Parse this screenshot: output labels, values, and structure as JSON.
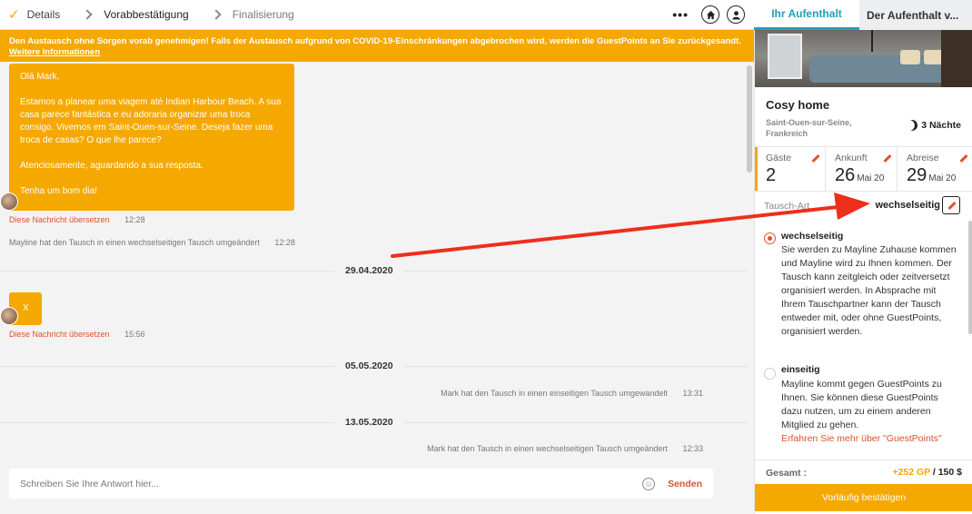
{
  "steps": [
    {
      "label": "Details",
      "state": "done"
    },
    {
      "label": "Vorabbestätigung",
      "state": "active"
    },
    {
      "label": "Finalisierung",
      "state": "pending"
    }
  ],
  "top_actions": {
    "more": "•••",
    "home_icon": "home-icon",
    "user_icon": "user-icon"
  },
  "tabs": {
    "active": "Ihr Aufenthalt",
    "inactive": "Der Aufenthalt v..."
  },
  "banner": {
    "text": "Den Austausch ohne Sorgen vorab genehmigen! Falls der Austausch aufgrund von COVID-19-Einschränkungen abgebrochen wird, werden die GuestPoints an Sie zurückgesandt.",
    "link": "Weitere Informationen"
  },
  "messages": {
    "first": {
      "greeting": "Olá Mark,",
      "body": "Estamos a planear uma viagem até Indian Harbour Beach. A sua casa parece fantástica e eu adoraria organizar uma troca consigo. Vivemos em Saint-Ouen-sur-Seine. Deseja fazer uma troca de casas? O que lhe parece?",
      "closing": "Atenciosamente, aguardando a sua resposta.",
      "sign": "Tenha um bom dia!",
      "translate": "Diese Nachricht übersetzen",
      "time": "12:28"
    },
    "system1": {
      "text": "Mayline hat den Tausch in einen wechselseitigen Tausch umgeändert",
      "time": "12:28"
    },
    "date1": "29.04.2020",
    "second": {
      "body": "X",
      "translate": "Diese Nachricht übersetzen",
      "time": "15:56"
    },
    "date2": "05.05.2020",
    "system2": {
      "text": "Mark hat den Tausch in einen einseitigen Tausch umgewandelt",
      "time": "13:31"
    },
    "date3": "13.05.2020",
    "system3": {
      "text": "Mark hat den Tausch in einen wechselseitigen Tausch umgeändert",
      "time": "12:33"
    }
  },
  "reply": {
    "placeholder": "Schreiben Sie Ihre Antwort hier...",
    "send": "Senden"
  },
  "home": {
    "title": "Cosy home",
    "location": "Saint-Ouen-sur-Seine, Frankreich",
    "nights": "3 Nächte"
  },
  "stay": {
    "guests": {
      "label": "Gäste",
      "value": "2"
    },
    "arrival": {
      "label": "Ankunft",
      "day": "26",
      "month": "Mai 20"
    },
    "departure": {
      "label": "Abreise",
      "day": "29",
      "month": "Mai 20"
    }
  },
  "exchange_type": {
    "label": "Tausch-Art",
    "value": "wechselseitig"
  },
  "options": [
    {
      "title": "wechselseitig",
      "selected": true,
      "desc": "Sie werden zu Mayline Zuhause kommen und Mayline wird zu Ihnen kommen. Der Tausch kann zeitgleich oder zeitversetzt organisiert werden. In Absprache mit Ihrem Tauschpartner kann der Tausch entweder mit, oder ohne GuestPoints, organisiert werden."
    },
    {
      "title": "einseitig",
      "selected": false,
      "desc": "Mayline kommt gegen GuestPoints zu Ihnen. Sie können diese GuestPoints dazu nutzen, um zu einem anderen Mitglied zu gehen.",
      "link": "Erfahren Sie mehr über \"GuestPoints\""
    }
  ],
  "total": {
    "label": "Gesamt :",
    "gp": "+252 GP",
    "price": "/ 150 $"
  },
  "confirm": "Vorläufig bestätigen",
  "colors": {
    "accent": "#f5a800",
    "teal": "#1ea1b8",
    "red": "#e0522a"
  }
}
